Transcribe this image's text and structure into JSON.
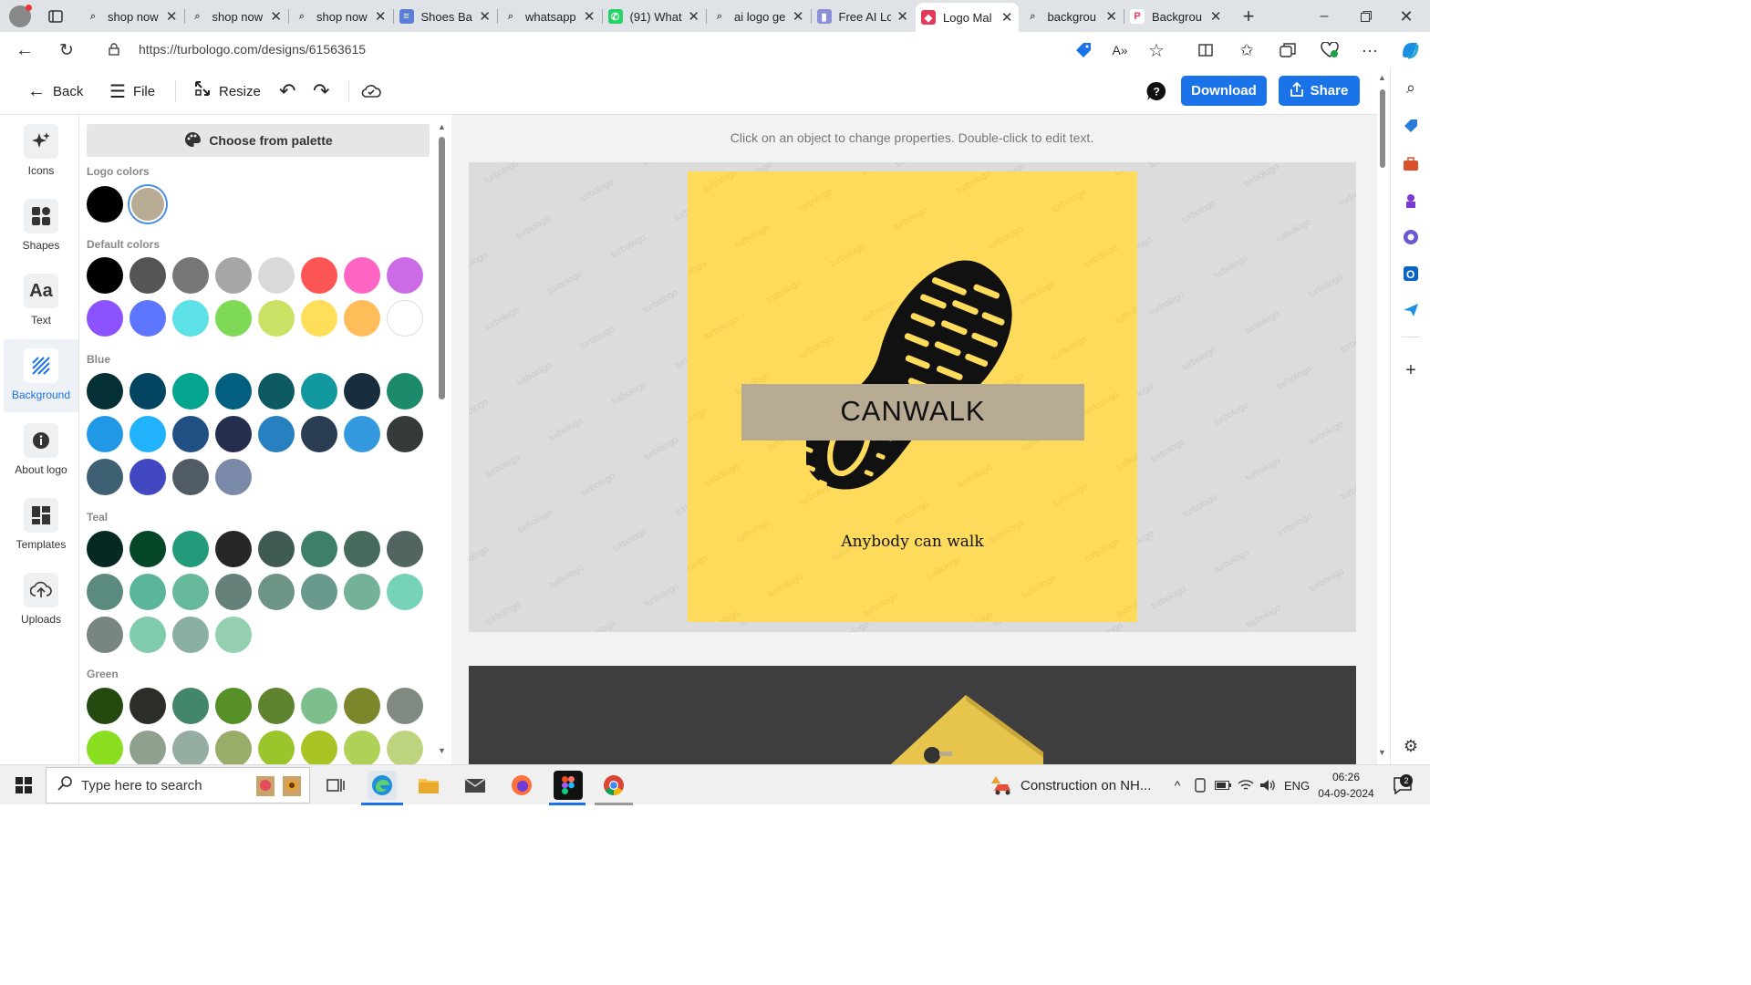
{
  "browser": {
    "tabs": [
      {
        "title": "shop now",
        "icon": "search-icon"
      },
      {
        "title": "shop now",
        "icon": "search-icon"
      },
      {
        "title": "shop now",
        "icon": "search-icon"
      },
      {
        "title": "Shoes Ba",
        "icon": "forms-icon"
      },
      {
        "title": "whatsapp",
        "icon": "search-icon"
      },
      {
        "title": "(91) What",
        "icon": "whatsapp-icon"
      },
      {
        "title": "ai logo ge",
        "icon": "search-icon"
      },
      {
        "title": "Free AI Lo",
        "icon": "site-icon"
      },
      {
        "title": "Logo Mal",
        "icon": "turbologo-icon",
        "active": true
      },
      {
        "title": "backgrou",
        "icon": "search-icon"
      },
      {
        "title": "Backgrou",
        "icon": "site-p-icon"
      }
    ],
    "url": "https://turbologo.com/designs/61563615"
  },
  "toolbar": {
    "back": "Back",
    "file": "File",
    "resize": "Resize",
    "download": "Download",
    "share": "Share"
  },
  "leftnav": [
    {
      "label": "Icons",
      "icon": "sparkle-icon"
    },
    {
      "label": "Shapes",
      "icon": "shapes-icon"
    },
    {
      "label": "Text",
      "icon": "text-icon",
      "glyph": "Aa"
    },
    {
      "label": "Background",
      "icon": "background-icon",
      "active": true
    },
    {
      "label": "About logo",
      "icon": "info-icon"
    },
    {
      "label": "Templates",
      "icon": "templates-icon"
    },
    {
      "label": "Uploads",
      "icon": "upload-icon"
    }
  ],
  "panel": {
    "palette_button": "Choose from palette",
    "logo_colors_label": "Logo colors",
    "logo_colors": [
      "#000000",
      "#b7ab94"
    ],
    "default_label": "Default colors",
    "default_colors": [
      "#000000",
      "#555555",
      "#777777",
      "#a6a6a6",
      "#d9d9d9",
      "#fd5554",
      "#ff66c4",
      "#cb6ce6",
      "#8c52ff",
      "#5e75ff",
      "#5ce1e6",
      "#7ed957",
      "#c9e265",
      "#ffde59",
      "#ffbd59",
      "#ffffff"
    ],
    "blue_label": "Blue",
    "blue_colors": [
      "#042f35",
      "#034460",
      "#03a58e",
      "#035f80",
      "#0e5a63",
      "#12999f",
      "#182e3f",
      "#1e8a6c",
      "#2098e6",
      "#20b3fb",
      "#215084",
      "#252f4d",
      "#2780c0",
      "#2b3d53",
      "#3499de",
      "#353b3a",
      "#3f5f73",
      "#4148c2",
      "#505b66",
      "#7b8aa8"
    ],
    "teal_label": "Teal",
    "teal_colors": [
      "#062a23",
      "#06472a",
      "#239a79",
      "#262626",
      "#3f5a52",
      "#3d7f68",
      "#466b5c",
      "#526561",
      "#5b8b7f",
      "#5bb59d",
      "#66b99a",
      "#66817a",
      "#6d9484",
      "#6a9a8e",
      "#74b298",
      "#76d2b8",
      "#79867f",
      "#80cbac",
      "#8aaea2",
      "#95cfb1"
    ],
    "green_label": "Green",
    "green_colors": [
      "#244a10",
      "#2b2d28",
      "#43876a",
      "#578f27",
      "#5f832f",
      "#7dbe8d",
      "#7c862b",
      "#808a81",
      "#89de1f",
      "#90a08e",
      "#95aea1",
      "#99ac68",
      "#9bc62b",
      "#a8c424",
      "#aed157",
      "#bdd37e"
    ]
  },
  "canvas": {
    "hint": "Click on an object to change properties. Double-click to edit text.",
    "watermark": "turbologo",
    "logo": {
      "brand": "CANWALK",
      "slogan": "Anybody can walk",
      "background": "#fedb5a",
      "banner_color": "#b7ab94"
    }
  },
  "taskbar": {
    "search_placeholder": "Type here to search",
    "notification": "Construction on NH...",
    "language": "ENG",
    "time": "06:26",
    "date": "04-09-2024",
    "badge": "2"
  }
}
